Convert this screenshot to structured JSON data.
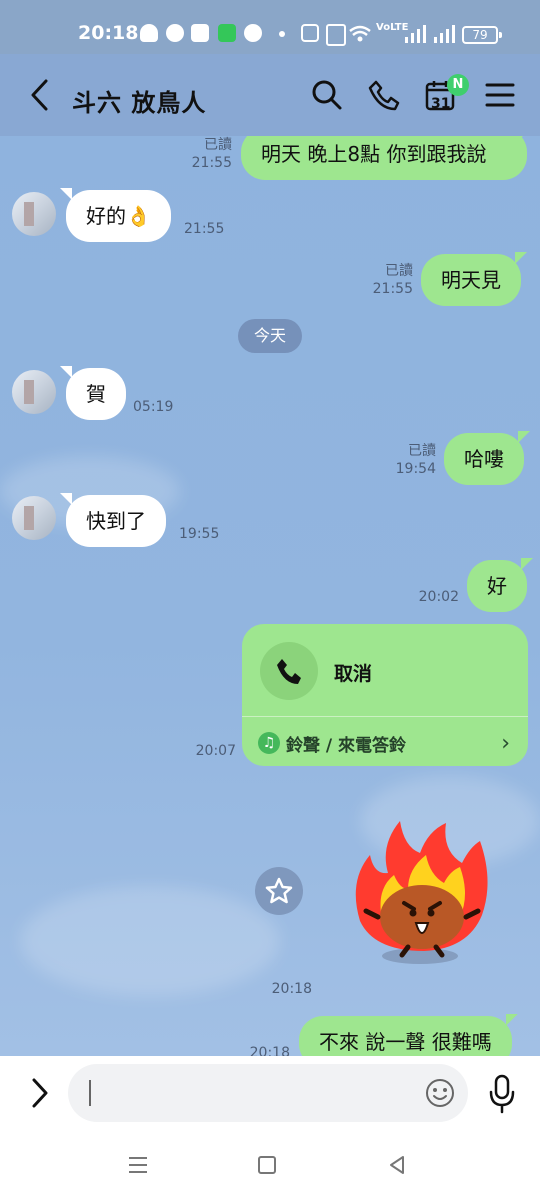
{
  "status": {
    "time": "20:18",
    "network": "VoLTE",
    "battery": "79"
  },
  "header": {
    "title": "斗六 放鳥人",
    "calendar_day": "31",
    "badge": "N"
  },
  "chat": {
    "day_separator": "今天",
    "messages": [
      {
        "side": "out",
        "text": "明天 晚上8點 你到跟我說",
        "read": "已讀",
        "time": "21:55"
      },
      {
        "side": "in",
        "text": "好的👌",
        "time": "21:55"
      },
      {
        "side": "out",
        "text": "明天見",
        "read": "已讀",
        "time": "21:55"
      },
      {
        "side": "in",
        "text": "賀",
        "time": "05:19"
      },
      {
        "side": "out",
        "text": "哈嘍",
        "read": "已讀",
        "time": "19:54"
      },
      {
        "side": "in",
        "text": "快到了",
        "time": "19:55"
      },
      {
        "side": "out",
        "text": "好",
        "time": "20:02"
      },
      {
        "side": "out",
        "type": "call",
        "text": "取消",
        "ringtone": "鈴聲 / 來電答鈴",
        "time": "20:07"
      },
      {
        "side": "out",
        "type": "sticker",
        "time": "20:18"
      },
      {
        "side": "out",
        "text": "不來 說一聲 很難嗎",
        "time": "20:18"
      }
    ]
  },
  "input": {
    "placeholder": ""
  },
  "icons": {
    "back": "back-chevron-icon",
    "search": "search-icon",
    "call": "phone-icon",
    "calendar": "calendar-icon",
    "menu": "menu-icon",
    "emoji": "emoji-icon",
    "mic": "microphone-icon",
    "star": "star-icon"
  },
  "colors": {
    "header_bg": "#89a8d3",
    "chat_bg": "#8fb3de",
    "outgoing_bubble": "#9ee68f",
    "incoming_bubble": "#ffffff",
    "badge": "#3fcf6d"
  }
}
